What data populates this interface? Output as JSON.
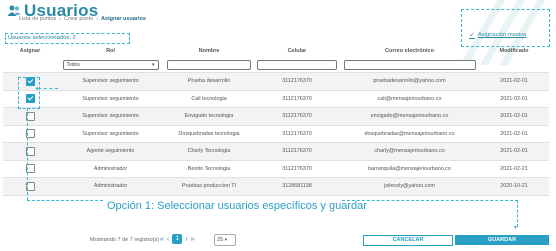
{
  "header": {
    "title": "Usuarios",
    "breadcrumb": [
      "Lista de puntos",
      "Crear punto",
      "Asignar usuarios"
    ]
  },
  "selection": {
    "label": "Usuarios seleccionados:",
    "count": "2"
  },
  "massive_assign": {
    "label": "Asignación masiva"
  },
  "table": {
    "columns": [
      "Asignar",
      "Rol",
      "Nombre",
      "Celular",
      "Correo electrónico",
      "Modificado"
    ],
    "role_filter": "Todos",
    "rows": [
      {
        "checked": true,
        "rol": "Supervisor seguimiento",
        "nombre": "Prueba desarrollo",
        "celular": "3112176370",
        "correo": "pruebadesarrollo@yahoo.com",
        "modificado": "2021-02-01"
      },
      {
        "checked": true,
        "rol": "Supervisor seguimiento",
        "nombre": "Cali tecnologia",
        "celular": "3112176370",
        "correo": "cali@mensajeriourbano.co",
        "modificado": "2021-02-01"
      },
      {
        "checked": false,
        "rol": "Supervisor seguimiento",
        "nombre": "Envigado tecnologia",
        "celular": "3112176370",
        "correo": "envigado@mensajeriourbano.co",
        "modificado": "2021-02-01"
      },
      {
        "checked": false,
        "rol": "Supervisor seguimiento",
        "nombre": "Dosquebradas tecnologia",
        "celular": "3112176370",
        "correo": "dosquebradas@mensajeriourbano.co",
        "modificado": "2021-02-01"
      },
      {
        "checked": false,
        "rol": "Agente seguimiento",
        "nombre": "Charly Tecnologia",
        "celular": "3112176370",
        "correo": "charly@mensajeriourbano.co",
        "modificado": "2021-02-01"
      },
      {
        "checked": false,
        "rol": "Administrador",
        "nombre": "Benito Tecnologia",
        "celular": "3112176370",
        "correo": "barranquila@mensajeriourbano.co",
        "modificado": "2021-02-21"
      },
      {
        "checked": false,
        "rol": "Administrador",
        "nombre": "Pruebas produccion TI",
        "celular": "3128681138",
        "correo": "jsilecely@yahoo.com",
        "modificado": "2020-10-21"
      }
    ]
  },
  "annotation": {
    "prefix": "Opción 1:",
    "text": " Seleccionar usuarios específicos y guardar"
  },
  "pagination": {
    "info": "Mostrando 7 de 7 registro(s)",
    "page": "1",
    "per_page": "25"
  },
  "buttons": {
    "cancel": "CANCELAR",
    "save": "GUARDAR"
  },
  "colors": {
    "accent": "#2a9fc4",
    "title": "#2a8aa6"
  }
}
